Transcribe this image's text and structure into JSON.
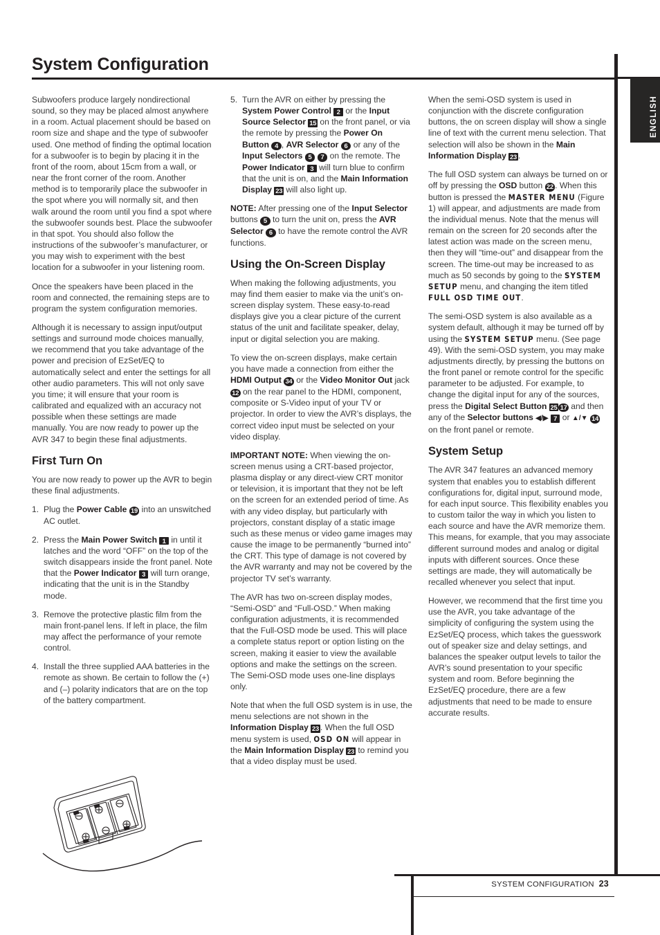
{
  "page": {
    "title": "System Configuration",
    "language_tab": "ENGLISH",
    "footer_section": "SYSTEM CONFIGURATION",
    "footer_page_number": "23"
  },
  "col1": {
    "p1": "Subwoofers produce largely nondirectional sound, so they may be placed almost anywhere in a room. Actual placement should be based on room size and shape and the type of subwoofer used. One method of finding the optimal location for a subwoofer is to begin by placing it in the front of the room, about 15cm from a wall, or near the front corner of the room. Another method is to temporarily place the subwoofer in the spot where you will normally sit, and then walk around the room until you find a spot where the subwoofer sounds best. Place the subwoofer in that spot. You should also follow the instructions of the subwoofer’s manufacturer, or you may wish to experiment with the best location for a subwoofer in your listening room.",
    "p2": "Once the speakers have been placed in the room and connected, the remaining steps are to program the system configuration memories.",
    "p3": "Although it is necessary to assign input/output settings and surround mode choices manually, we recommend that you take advantage of the power and precision of EzSet/EQ to automatically select and enter the settings for all other audio parameters. This will not only save you time; it will ensure that your room is calibrated and equalized with an accuracy not possible when these settings are made manually. You are now ready to power up the AVR 347 to begin these final adjustments.",
    "heading_first_turn_on": "First Turn On",
    "p4": "You are now ready to power up the AVR to begin these final adjustments.",
    "steps": [
      {
        "num": "1.",
        "pre": "Plug the ",
        "bold1": "Power Cable",
        "badge1": "19",
        "badge1_shape": "round",
        "post": " into an unswitched AC outlet."
      },
      {
        "num": "2.",
        "pre": "Press the ",
        "bold1": "Main Power Switch",
        "badge1": "1",
        "badge1_shape": "square",
        "mid": " in until it latches and the word “OFF” on the top of the switch disappears inside the front panel. Note that the ",
        "bold2": "Power Indicator",
        "badge2": "3",
        "badge2_shape": "square",
        "post": " will turn orange, indicating that the unit is in the Standby mode."
      },
      {
        "num": "3.",
        "text": "Remove the protective plastic film from the main front-panel lens. If left in place, the film may affect the performance of your remote control."
      },
      {
        "num": "4.",
        "text": "Install the three supplied AAA batteries in the remote as shown. Be certain to follow the (+) and (–) polarity indicators that are on the top of the battery compartment."
      }
    ],
    "illustration_name": "remote-battery-compartment"
  },
  "col2": {
    "step5": {
      "num": "5.",
      "t1": "Turn the AVR on either by pressing the ",
      "b1": "System Power Control",
      "n1": "2",
      "t2": " or the ",
      "b2": "Input Source Selector",
      "n2": "15",
      "t3": " on the front panel, or via the remote by pressing the ",
      "b3": "Power On Button",
      "n3": "4",
      "t4": ", ",
      "b4": "AVR Selector",
      "n4": "6",
      "t5": " or any of the ",
      "b5": "Input Selectors",
      "n5": "5",
      "n6": "7",
      "t6": " on the remote. The ",
      "b6": "Power Indicator",
      "n7": "3",
      "t7": " will turn blue to confirm that the unit is on, and the ",
      "b7": "Main Information Display",
      "n8": "23",
      "t8": " will also light up."
    },
    "note": {
      "label": "NOTE:",
      "t1": " After pressing one of the ",
      "b1": "Input Selector",
      "t2": " buttons ",
      "n1": "5",
      "t3": " to turn the unit on, press the ",
      "b2": "AVR Selector",
      "n2": "6",
      "t4": " to have the remote control the AVR functions."
    },
    "heading_osd": "Using the On-Screen Display",
    "p1": "When making the following adjustments, you may find them easier to make via the unit’s on-screen display system. These easy-to-read displays give you a clear picture of the current status of the unit and facilitate speaker, delay, input or digital selection you are making.",
    "p2": {
      "t1": "To view the on-screen displays, make certain you have made a connection from either the ",
      "b1": "HDMI Output",
      "n1": "34",
      "t2": " or the ",
      "b2": "Video Monitor Out",
      "t3": " jack ",
      "n2": "12",
      "t4": " on the rear panel to the HDMI, component, composite or S-Video input of your TV or projector. In order to view the AVR’s displays, the correct video input must be selected on your video display."
    },
    "important": {
      "label": "IMPORTANT NOTE:",
      "text": " When viewing the on-screen menus using a CRT-based projector, plasma display or any direct-view CRT monitor or television, it is important that they not be left on the screen for an extended period of time. As with any video display, but particularly with projectors, constant display of a static image such as these menus or video game images may cause the image to be permanently “burned into” the CRT. This type of damage is not covered by the AVR warranty and may not be covered by the projector TV set’s warranty."
    },
    "p3": "The AVR has two on-screen display modes, “Semi-OSD” and “Full-OSD.” When making configuration adjustments, it is recommended that the Full-OSD mode be used. This will place a complete status report or option listing on the screen, making it easier to view the available options and make the settings on the screen. The Semi-OSD mode uses one-line displays only.",
    "p4": {
      "t1": "Note that when the full OSD system is in use, the menu selections are not shown in the ",
      "b1": "Information Display",
      "n1": "23",
      "t2": ". When the full OSD menu system is used, ",
      "lcd1": "OSD ON",
      "t3": " will appear in the ",
      "b2": "Main Information Display",
      "n2": "23",
      "t4": " to remind you that a video display must be used."
    }
  },
  "col3": {
    "p1": {
      "t1": "When the semi-OSD system is used in conjunction with the discrete configuration buttons, the on screen display will show a single line of text with the current menu selection. That selection will also be shown in the ",
      "b1": "Main Information Display",
      "n1": "23",
      "t2": "."
    },
    "p2": {
      "t1": "The full OSD system can always be turned on or off by pressing the ",
      "b1": "OSD",
      "t2": " button ",
      "n1": "22",
      "t3": ". When this button is pressed the ",
      "lcd1": "MASTER MENU",
      "t4": " (Figure 1) will appear, and adjustments are made from the individual menus. Note that the menus will remain on the screen for 20 seconds after the latest action was made on the screen menu, then they will “time-out” and disappear from the screen. The time-out may be increased to as much as 50 seconds by going to the ",
      "lcd2": "SYSTEM SETUP",
      "t5": " menu, and changing the item titled ",
      "lcd3": "FULL OSD TIME OUT",
      "t6": "."
    },
    "p3": {
      "t1": "The semi-OSD system is also available as a system default, although it may be turned off by using the ",
      "lcd1": "SYSTEM SETUP",
      "t2": " menu. (See page 49). With the semi-OSD system, you may make adjustments directly, by pressing the buttons on the front panel or remote control for the specific parameter to be adjusted. For example, to change the digital input for any of the sources, press the ",
      "b1": "Digital Select Button",
      "n1": "25",
      "n2": "17",
      "t3": " and then any of the ",
      "b2": "Selector buttons",
      "arrow1": "◀/▶",
      "n3": "7",
      "t4": " or ",
      "arrow2": "▲/▼",
      "n4": "14",
      "t5": " on the front panel or remote."
    },
    "heading_system_setup": "System Setup",
    "p4": "The AVR 347 features an advanced memory system that enables you to establish different configurations for, digital input, surround mode, for each input source. This flexibility enables you to custom tailor the way in which you listen to each source and have the AVR memorize them. This means, for example, that you may associate different surround modes and analog or digital inputs with different sources. Once these settings are made, they will automatically be recalled whenever you select that input.",
    "p5": "However, we recommend that the first time you use the AVR, you take advantage of the simplicity of configuring the system using the EzSet/EQ process, which takes the guesswork out of speaker size and delay settings, and balances the speaker output levels to tailor the AVR’s sound presentation to your specific system and room. Before beginning the EzSet/EQ procedure, there are a few adjustments that need to be made to ensure accurate results."
  },
  "colors": {
    "ink": "#231f20",
    "body_text": "#3a3a3a",
    "tab_background": "#272625"
  }
}
